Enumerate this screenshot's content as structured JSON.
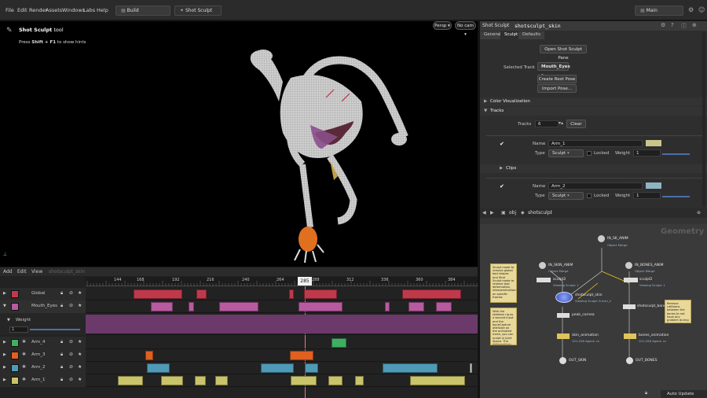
{
  "menubar": {
    "items": [
      "File",
      "Edit",
      "Render",
      "Assets",
      "Windows",
      "Labs",
      "Help"
    ],
    "desktop": "Build",
    "shelf_tab": "Shot Sculpt",
    "right_desktop": "Main"
  },
  "viewport": {
    "tool_name": "Shot Sculpt",
    "tool_suffix": "tool",
    "hint_prefix": "Press",
    "hint_keys": "Shift + F1",
    "hint_suffix": "to show hints",
    "persp": "Persp",
    "cam": "No cam"
  },
  "params": {
    "type_label": "Shot Sculpt",
    "node_name": "shotsculpt_skin",
    "tabs": [
      "General",
      "Sculpt",
      "Defaults"
    ],
    "open_pane_button": "Open Shot Sculpt Pane",
    "selected_track_label": "Selected Track",
    "selected_track_value": "Mouth_Eyes",
    "create_rest_pose": "Create Rest Pose",
    "import_pose": "Import Pose...",
    "color_vis_section": "Color Visualization",
    "tracks_section": "Tracks",
    "tracks_label": "Tracks",
    "tracks_count": "6",
    "clear_button": "Clear",
    "track1": {
      "name_label": "Name",
      "name": "Arm_1",
      "type_label": "Type",
      "type": "Sculpt",
      "locked": "Locked",
      "weight_label": "Weight",
      "weight": "1",
      "swatch": "#c8c58a"
    },
    "clips_section": "Clips",
    "track2": {
      "name_label": "Name",
      "name": "Arm_2",
      "type_label": "Type",
      "type": "Sculpt",
      "locked": "Locked",
      "weight_label": "Weight",
      "weight": "1",
      "swatch": "#8fb4c4"
    }
  },
  "network": {
    "path_root": "obj",
    "path_node": "shotsculpt",
    "context_label": "Geometry",
    "nodes": {
      "skin_anim": {
        "name": "IN_SKIN_ANIM",
        "sub": "Object Merge"
      },
      "sk_anim": {
        "name": "IN_SK_ANIM",
        "sub": "Object Merge"
      },
      "bones_anim": {
        "name": "IN_BONES_ANIM",
        "sub": "Object Merge"
      },
      "sculpt2a": {
        "name": "sculpt2",
        "sub": "Viewing Sculpt: 1"
      },
      "sculpt2b": {
        "name": "sculpt2",
        "sub": "Viewing Sculpt: 1"
      },
      "shotsculpt": {
        "name": "shotsculpt_skin",
        "sub": "Viewing Sculpt: 6 Arm_2"
      },
      "shotbones": {
        "name": "shotsculpt_bones",
        "sub": ""
      },
      "peak": {
        "name": "peak_cornea",
        "sub": ""
      },
      "skin_animation": {
        "name": "skin_animation",
        "sub": "101-258 Agent: cz"
      },
      "bones_animation": {
        "name": "bones_animation",
        "sub": "101-258 Agent: cz"
      },
      "out_skin": {
        "name": "OUT_SKIN",
        "sub": ""
      },
      "out_bones": {
        "name": "OUT_BONES",
        "sub": ""
      }
    },
    "note1": "Sculpt mode to remove global bad shapes and Shot Sculpt mode to remove bad deformation, interpenetrations... on specific frames",
    "note2": "With the skeleton rig as a second input and the boneCapture attribute on the animated mesh, you can sculpt in Joint Space. The deformations will follow the animation of the animation based on the boneCapture attribute",
    "note3": "Remove collisions between the bones to not have any problem during the muscle simulation",
    "auto_update": "Auto Update"
  },
  "timeline": {
    "menu": [
      "Add",
      "Edit",
      "View"
    ],
    "node": "shotsculpt_skin",
    "ticks": [
      "144",
      "168",
      "192",
      "216",
      "240",
      "264",
      "288",
      "312",
      "336",
      "360",
      "384"
    ],
    "current_frame": "285",
    "weight_label": "Weight",
    "weight_value": "1",
    "tracks": [
      {
        "name": "Global",
        "color": "#c0394b"
      },
      {
        "name": "Mouth_Eyes",
        "color": "#b85aa0"
      },
      {
        "name": "Arm_4",
        "color": "#3fae63"
      },
      {
        "name": "Arm_3",
        "color": "#e06020"
      },
      {
        "name": "Arm_2",
        "color": "#4f9ab7"
      },
      {
        "name": "Arm_1",
        "color": "#c9c46a"
      }
    ]
  }
}
